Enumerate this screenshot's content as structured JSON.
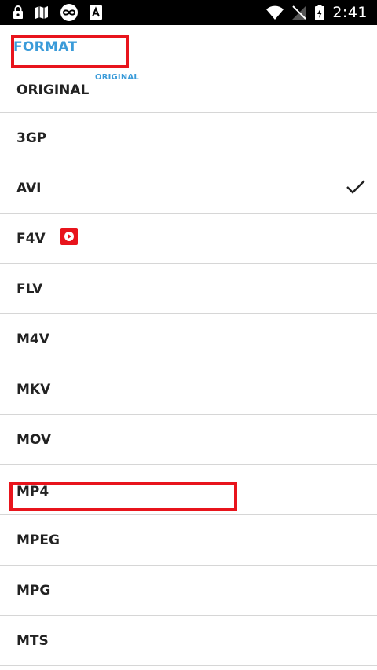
{
  "status_bar": {
    "time": "2:41",
    "left_icons": [
      "lock-icon",
      "map-icon",
      "infinity-icon",
      "font-a-icon"
    ],
    "right_icons": [
      "wifi-icon",
      "no-signal-icon",
      "battery-charging-icon"
    ]
  },
  "header": {
    "title": "FORMAT",
    "selected_value": "ORIGINAL",
    "first_option": "ORIGINAL"
  },
  "options": [
    {
      "label": "3GP"
    },
    {
      "label": "AVI",
      "checked": true
    },
    {
      "label": "F4V",
      "badge": "play-icon"
    },
    {
      "label": "FLV"
    },
    {
      "label": "M4V"
    },
    {
      "label": "MKV"
    },
    {
      "label": "MOV"
    },
    {
      "label": "MP4"
    },
    {
      "label": "MPEG"
    },
    {
      "label": "MPG"
    },
    {
      "label": "MTS"
    }
  ],
  "colors": {
    "accent": "#3a9bd9",
    "highlight": "#e8141c",
    "text": "#222222",
    "divider": "#d6d6d6",
    "status_bar": "#000000"
  }
}
